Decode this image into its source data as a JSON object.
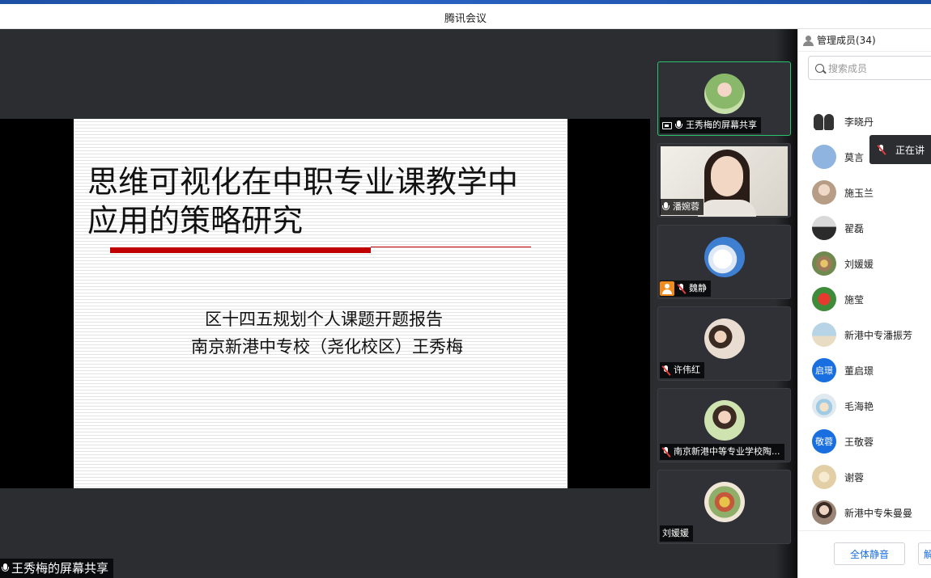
{
  "window": {
    "title": "腾讯会议"
  },
  "slide": {
    "title_line1": "思维可视化在中职专业课教学中",
    "title_line2": "应用的策略研究",
    "subtitle_line1": "区十四五规划个人课题开题报告",
    "subtitle_line2": "南京新港中专校（尧化校区）王秀梅"
  },
  "share_label": "王秀梅的屏幕共享",
  "video_tiles": [
    {
      "name": "王秀梅的屏幕共享",
      "mic": "on",
      "active": true,
      "screen_share": true
    },
    {
      "name": "潘婉蓉",
      "mic": "on",
      "active": false,
      "camera": true
    },
    {
      "name": "魏静",
      "mic": "off",
      "active": false,
      "badge": "person-icon"
    },
    {
      "name": "许伟红",
      "mic": "off",
      "active": false
    },
    {
      "name": "南京新港中等专业学校陶...",
      "mic": "off",
      "active": false
    },
    {
      "name": "刘媛媛",
      "mic": "none",
      "active": false
    }
  ],
  "panel": {
    "header": "管理成员(34)",
    "search_placeholder": "搜索成员",
    "members": [
      {
        "name": "李晓丹",
        "avatar_text": "",
        "color": "#3b3b3b"
      },
      {
        "name": "莫言",
        "avatar_text": "",
        "color": "#8fb4e0"
      },
      {
        "name": "施玉兰",
        "avatar_text": "",
        "color": "#b79d86"
      },
      {
        "name": "翟磊",
        "avatar_text": "",
        "color": "#4a4a4a"
      },
      {
        "name": "刘媛媛",
        "avatar_text": "",
        "color": "#9c7a58"
      },
      {
        "name": "施莹",
        "avatar_text": "",
        "color": "#c9342b"
      },
      {
        "name": "新港中专潘振芳",
        "avatar_text": "",
        "color": "#b7d4e6"
      },
      {
        "name": "董启璟",
        "avatar_text": "启璟",
        "color": "#1a6fe0"
      },
      {
        "name": "毛海艳",
        "avatar_text": "",
        "color": "#dfe9ef"
      },
      {
        "name": "王敬蓉",
        "avatar_text": "敬蓉",
        "color": "#1a6fe0"
      },
      {
        "name": "谢蓉",
        "avatar_text": "",
        "color": "#e2cfa6"
      },
      {
        "name": "新港中专朱曼曼",
        "avatar_text": "",
        "color": "#9a8576"
      }
    ],
    "speaking_text": "正在讲",
    "mute_all_label": "全体静音",
    "unmute_label": "解"
  }
}
